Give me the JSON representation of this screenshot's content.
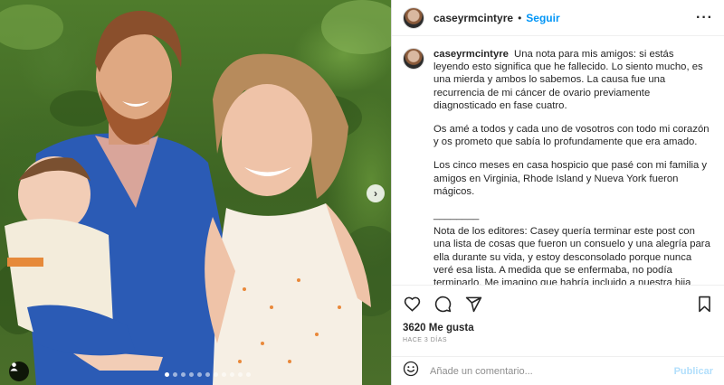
{
  "post": {
    "username": "caseyrmcintyre",
    "follow_label": "Seguir",
    "separator": "•",
    "more_icon": "ellipsis-icon",
    "caption": {
      "username": "caseyrmcintyre",
      "paragraph_1": "Una nota para mis amigos: si estás leyendo esto significa que he fallecido. Lo siento mucho, es una mierda y ambos lo sabemos. La causa fue una recurrencia de mi cáncer de ovario previamente diagnosticado en fase cuatro.",
      "paragraph_2": "Os amé a todos y cada uno de vosotros con todo mi corazón y os prometo que sabía lo profundamente que era amado.",
      "paragraph_3": "Los cinco meses en casa hospicio que pasé con mi familia y amigos en Virginia, Rhode Island y Nueva York fueron mágicos.",
      "rule": "________",
      "paragraph_4": "Nota de los editores: Casey quería terminar este post con una lista de cosas que fueron un consuelo y una alegría para ella durante su vida, y estoy desconsolado porque nunca veré esa lista. A medida que se enfermaba, no podía terminarlo. Me imagino que habría incluido a nuestra hija Grace, ballenas, helado, sus queridos amigos, estar en la playa, su sobrina y sobrinos que adoraba incorregiblemente, leyendo 10 libros en unas vacaciones de una semana, sus amados padres y hermana y"
    },
    "likes": "3620 Me gusta",
    "time_ago": "HACE 3 DÍAS",
    "comment_placeholder": "Añade un comentario...",
    "publish_label": "Publicar",
    "carousel": {
      "total_slides": 11,
      "active_slide": 1
    }
  },
  "colors": {
    "accent": "#0095f6",
    "publish_disabled": "#b2dffc",
    "text": "#262626",
    "muted": "#8e8e8e"
  }
}
